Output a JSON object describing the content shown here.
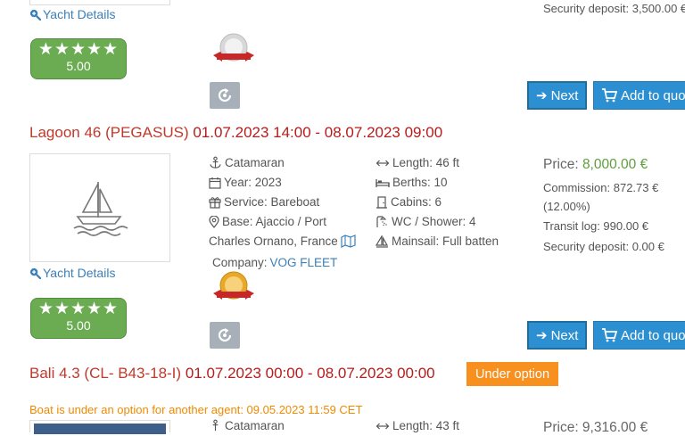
{
  "common": {
    "yacht_details_label": "Yacht Details",
    "next_label": "Next",
    "add_to_quote_label": "Add to quote",
    "stars": "★★★★★"
  },
  "listing_top": {
    "rating": "5.00",
    "security_deposit": "Security deposit: 3,500.00 €"
  },
  "listing_1": {
    "name": "Lagoon 46 (PEGASUS)",
    "dates": "01.07.2023 14:00 - 08.07.2023 09:00",
    "type": "Catamaran",
    "year": "Year: 2023",
    "service": "Service: Bareboat",
    "base_line1": "Base: Ajaccio / Port",
    "base_line2": "Charles Ornano,  France",
    "company_label": "Company:",
    "company": "VOG FLEET",
    "length": "Length: 46 ft",
    "berths": "Berths: 10",
    "cabins": "Cabins: 6",
    "wc": "WC / Shower: 4",
    "mainsail": "Mainsail: Full batten",
    "price_label": "Price:",
    "price": "8,000.00 €",
    "commission": "Commission: 872.73 €",
    "commission_pct": "(12.00%)",
    "transit_log": "Transit log: 990.00 €",
    "security_deposit": "Security deposit: 0.00 €",
    "rating": "5.00"
  },
  "listing_2": {
    "name": "Bali 4.3 (CL- B43-18-I)",
    "dates": "01.07.2023 00:00 - 08.07.2023 00:00",
    "status_badge": "Under option",
    "option_notice": "Boat is under an option for another agent: 09.05.2023 11:59 CET",
    "type": "Catamaran",
    "length": "Length: 43 ft",
    "price": "Price: 9,316.00 €"
  },
  "colors": {
    "title_red": "#c0392b",
    "button_blue": "#2c8fd1",
    "rating_green": "#6bac52",
    "price_green": "#5d9e3e",
    "option_orange": "#f7901e"
  }
}
